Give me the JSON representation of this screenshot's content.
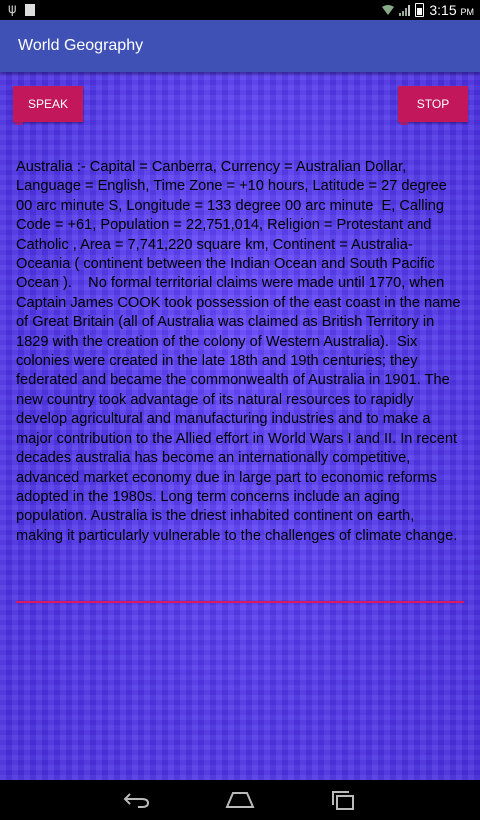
{
  "status": {
    "time": "3:15",
    "ampm": "PM"
  },
  "app": {
    "title": "World Geography"
  },
  "buttons": {
    "speak": "SPEAK",
    "stop": "STOP"
  },
  "content": {
    "text": "Australia :- Capital = Canberra, Currency = Australian Dollar, Language = English, Time Zone = +10 hours, Latitude = 27 degree 00 arc minute S, Longitude = 133 degree 00 arc minute  E, Calling Code = +61, Population = 22,751,014, Religion = Protestant and Catholic , Area = 7,741,220 square km, Continent = Australia-Oceania ( continent between the Indian Ocean and South Pacific Ocean ).    No formal territorial claims were made until 1770, when Captain James COOK took possession of the east coast in the name of Great Britain (all of Australia was claimed as British Territory in 1829 with the creation of the colony of Western Australia).  Six colonies were created in the late 18th and 19th centuries; they federated and became the commonwealth of Australia in 1901. The new country took advantage of its natural resources to rapidly develop agricultural and manufacturing industries and to make a major contribution to the Allied effort in World Wars I and II. In recent decades australia has become an internationally competitive, advanced market economy due in large part to economic reforms adopted in the 1980s. Long term concerns include an aging population. Australia is the driest inhabited continent on earth,  making it particularly vulnerable to the challenges of climate change."
  },
  "colors": {
    "action_bar": "#3f51b5",
    "button": "#c2185b",
    "background": "#5a3cf2",
    "underline": "#d81b60"
  },
  "icons": {
    "status_left": [
      "usb-icon",
      "notification-icon"
    ],
    "status_right": [
      "wifi-icon",
      "signal-icon",
      "battery-icon"
    ],
    "nav": [
      "back-icon",
      "home-icon",
      "recent-apps-icon"
    ]
  }
}
